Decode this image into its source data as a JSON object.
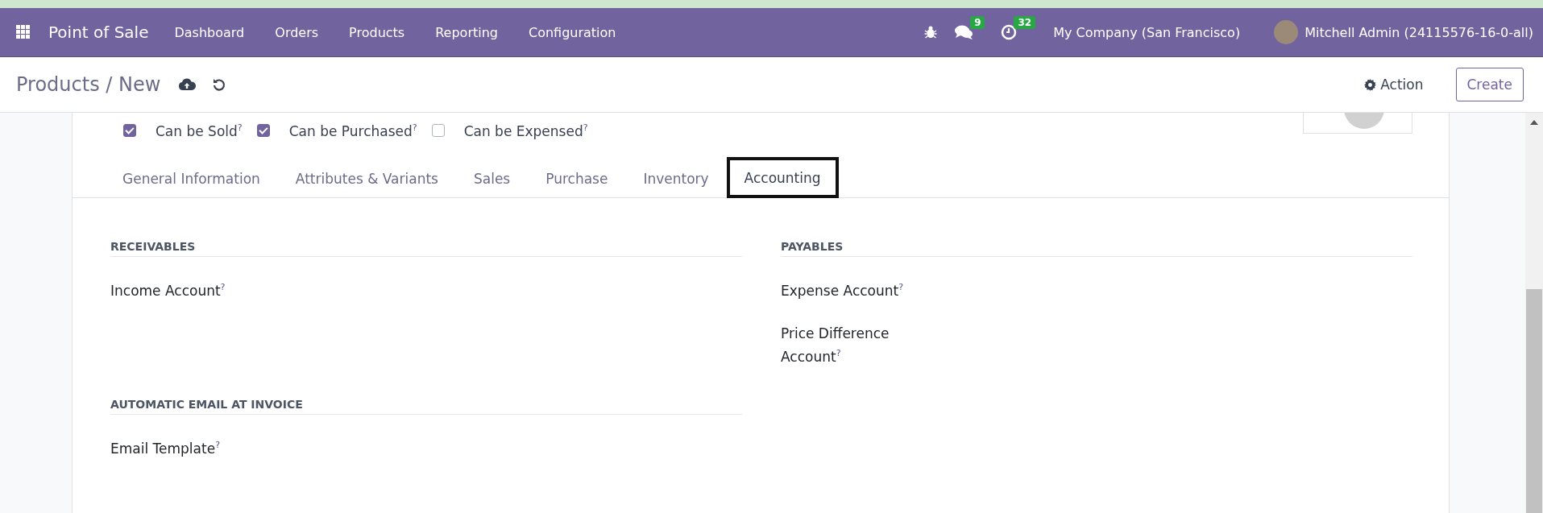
{
  "navbar": {
    "app_name": "Point of Sale",
    "menu": [
      "Dashboard",
      "Orders",
      "Products",
      "Reporting",
      "Configuration"
    ],
    "messages_count": "9",
    "activities_count": "32",
    "company": "My Company (San Francisco)",
    "user": "Mitchell Admin (24115576-16-0-all)"
  },
  "control_panel": {
    "breadcrumb": "Products / New",
    "action": "Action",
    "create": "Create"
  },
  "options": [
    {
      "label": "Can be Sold$^{?}$",
      "checked": true
    },
    {
      "label": "Can be Purchased$^{?}$",
      "checked": true
    },
    {
      "label": "Can be Expensed$^{?}$",
      "checked": false
    }
  ],
  "tabs": [
    {
      "label": "General Information",
      "selected": false
    },
    {
      "label": "Attributes & Variants",
      "selected": false
    },
    {
      "label": "Sales",
      "selected": false
    },
    {
      "label": "Purchase",
      "selected": false
    },
    {
      "label": "Inventory",
      "selected": false
    },
    {
      "label": "Accounting",
      "selected": true
    }
  ],
  "columns": [
    [
      {
        "title": "RECEIVABLES",
        "fields": [
          "Income Account$^{?}$"
        ]
      },
      {
        "title": "AUTOMATIC EMAIL AT INVOICE",
        "fields": [
          "Email Template$^{?}$"
        ]
      }
    ],
    [
      {
        "title": "PAYABLES",
        "fields": [
          "Expense Account$^{?}$",
          "Price Difference Account$^{?}$"
        ]
      }
    ]
  ]
}
